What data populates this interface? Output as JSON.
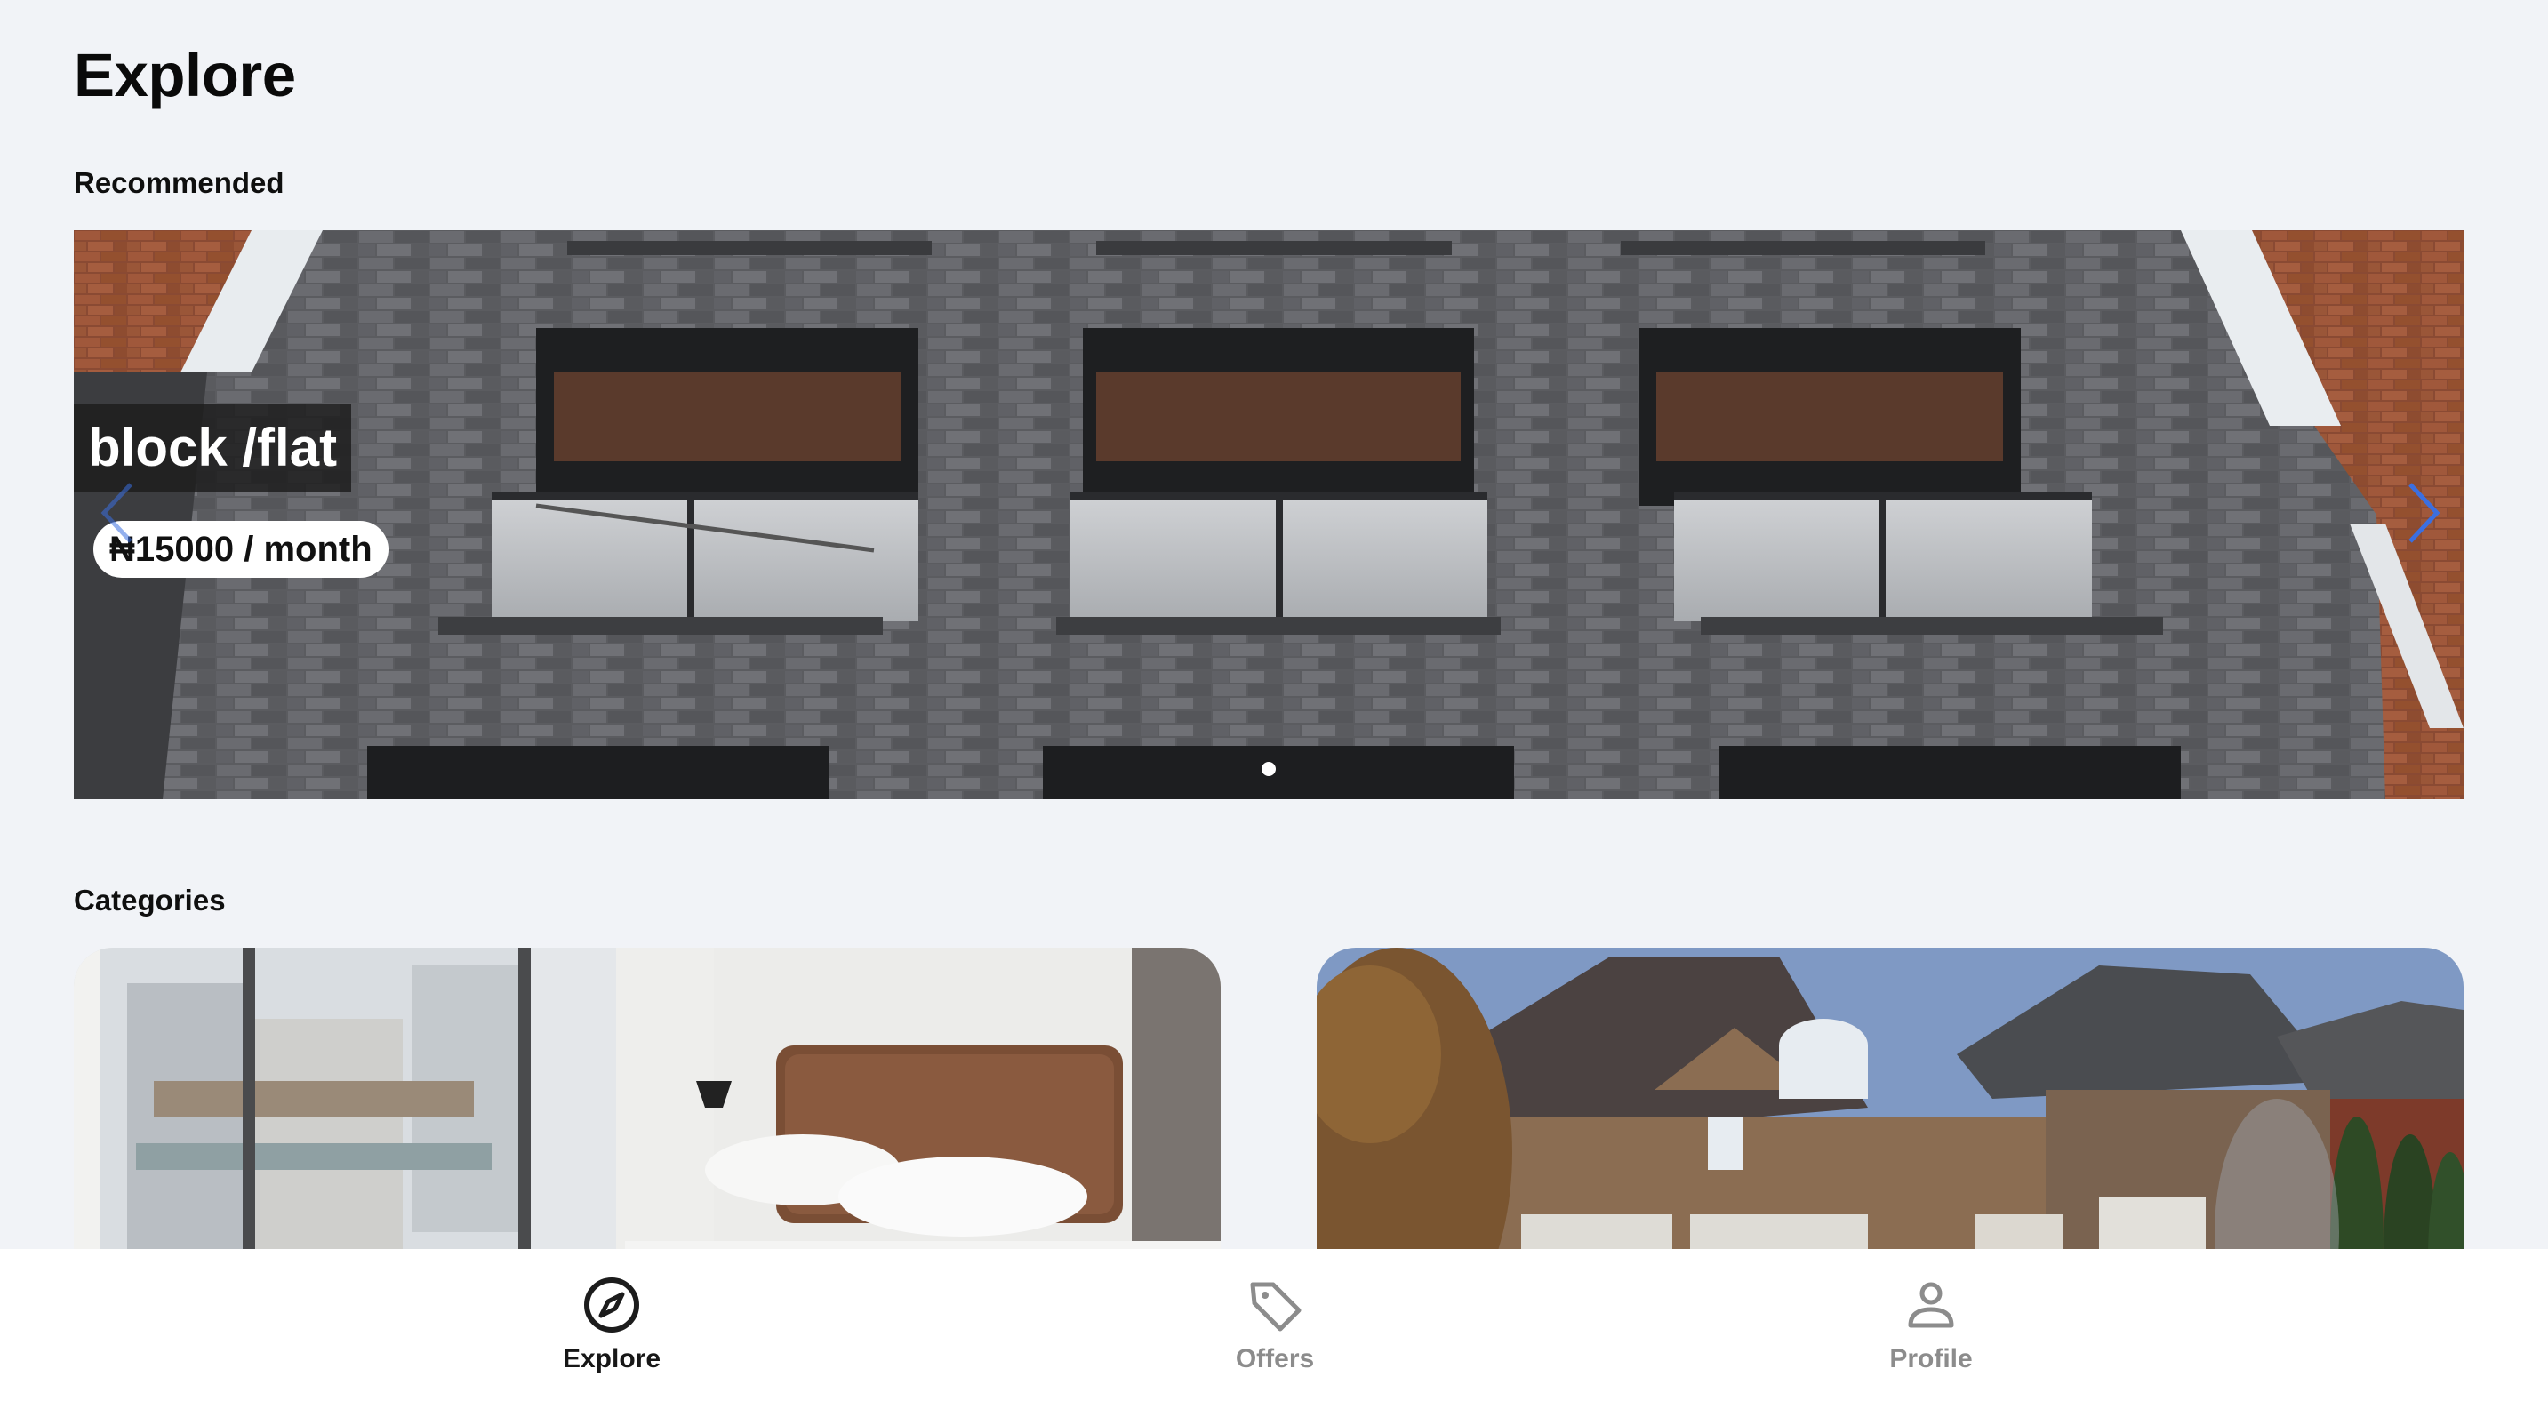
{
  "header": {
    "title": "Explore"
  },
  "recommended": {
    "section_label": "Recommended",
    "slides": [
      {
        "title": "block /flat",
        "price": "₦15000 / month"
      }
    ],
    "active_slide": 1,
    "slide_count": 1
  },
  "categories": {
    "section_label": "Categories"
  },
  "bottom_nav": {
    "items": [
      {
        "label": "Explore",
        "icon": "compass-icon",
        "active": true
      },
      {
        "label": "Offers",
        "icon": "tag-icon",
        "active": false
      },
      {
        "label": "Profile",
        "icon": "person-icon",
        "active": false
      }
    ]
  },
  "colors": {
    "background": "#f1f3f7",
    "nav_active": "#171717",
    "nav_inactive": "#8c8c8c",
    "carousel_arrow": "#3b6fe0"
  }
}
